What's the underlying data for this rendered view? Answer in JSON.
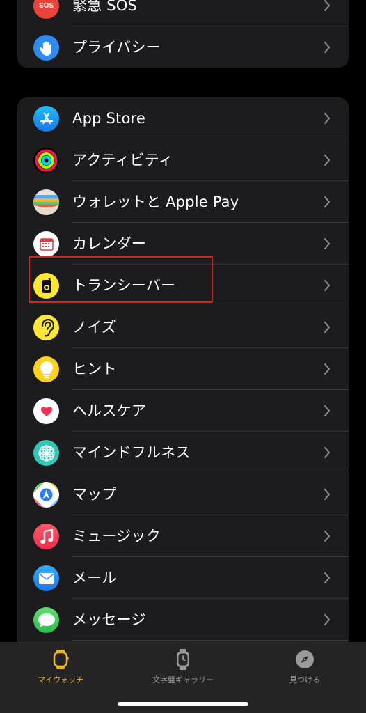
{
  "group_top": {
    "items": [
      {
        "label": "緊急 SOS",
        "icon": "sos-icon",
        "icon_text": "SOS",
        "color": "#e9443a"
      },
      {
        "label": "プライバシー",
        "icon": "hand-icon",
        "color": "#2e8bf0"
      }
    ]
  },
  "group_apps": {
    "items": [
      {
        "label": "App Store",
        "icon": "app-store-icon",
        "color": "#1f8ff2"
      },
      {
        "label": "アクティビティ",
        "icon": "activity-rings-icon",
        "color": "#000000"
      },
      {
        "label": "ウォレットと Apple Pay",
        "icon": "wallet-icon",
        "color": "#e8e3d9"
      },
      {
        "label": "カレンダー",
        "icon": "calendar-icon",
        "color": "#ffffff"
      },
      {
        "label": "トランシーバー",
        "icon": "walkie-talkie-icon",
        "color": "#ffe733"
      },
      {
        "label": "ノイズ",
        "icon": "ear-icon",
        "color": "#ffe733"
      },
      {
        "label": "ヒント",
        "icon": "lightbulb-icon",
        "color": "#ffd11f"
      },
      {
        "label": "ヘルスケア",
        "icon": "heart-icon",
        "color": "#ffffff"
      },
      {
        "label": "マインドフルネス",
        "icon": "flower-icon",
        "color": "#2fc8b8"
      },
      {
        "label": "マップ",
        "icon": "maps-icon",
        "color": "#ffffff"
      },
      {
        "label": "ミュージック",
        "icon": "music-note-icon",
        "color": "#f63d54"
      },
      {
        "label": "メール",
        "icon": "envelope-icon",
        "color": "#1e92f5"
      },
      {
        "label": "メッセージ",
        "icon": "speech-bubble-icon",
        "color": "#35c75a"
      }
    ]
  },
  "tabbar": {
    "tabs": [
      {
        "label": "マイウォッチ",
        "icon": "watch-icon",
        "active": true
      },
      {
        "label": "文字盤ギャラリー",
        "icon": "watch-face-icon",
        "active": false
      },
      {
        "label": "見つける",
        "icon": "compass-icon",
        "active": false
      }
    ]
  },
  "colors": {
    "accent": "#e9b529",
    "highlight_box": "#d0281f",
    "group_bg": "#1c1c1e"
  }
}
